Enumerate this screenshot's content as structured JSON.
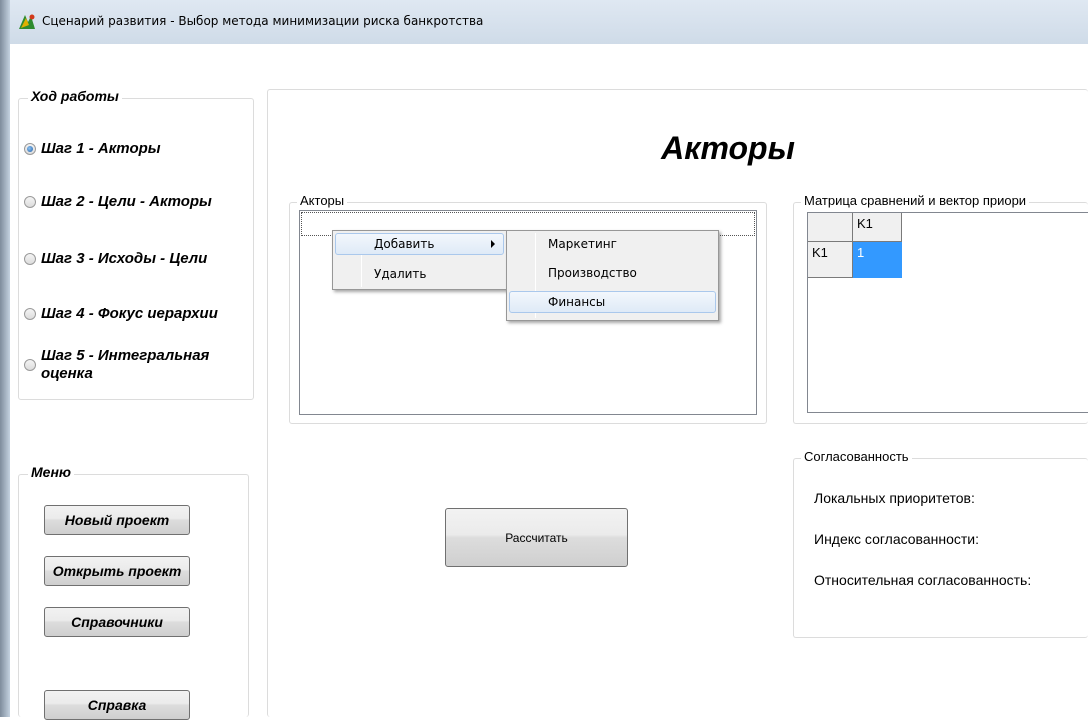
{
  "window": {
    "title": "Сценарий развития - Выбор метода минимизации риска банкротства",
    "icon": "app-logo-icon"
  },
  "progress": {
    "legend": "Ход работы",
    "selected_index": 0,
    "steps": [
      {
        "label": "Шаг 1 - Акторы"
      },
      {
        "label": "Шаг 2 - Цели - Акторы"
      },
      {
        "label": "Шаг 3 - Исходы - Цели"
      },
      {
        "label": "Шаг 4 - Фокус иерархии"
      },
      {
        "label": "Шаг 5 - Интегральная оценка"
      }
    ]
  },
  "menu": {
    "legend": "Меню",
    "new_project": "Новый проект",
    "open_project": "Открыть проект",
    "references": "Справочники",
    "help": "Справка"
  },
  "main": {
    "heading": "Акторы",
    "actors_legend": "Акторы",
    "matrix_legend": "Матрица сравнений  и вектор приори",
    "matrix": {
      "col_headers": [
        "K1"
      ],
      "rows": [
        {
          "header": "K1",
          "values": [
            "1"
          ]
        }
      ]
    },
    "consistency": {
      "legend": "Согласованность",
      "local_priorities": "Локальных приоритетов:",
      "consistency_index": "Индекс согласованности:",
      "relative_consistency": "Относительная согласованность:"
    },
    "calculate_button": "Рассчитать"
  },
  "context_menu": {
    "add": "Добавить",
    "delete": "Удалить",
    "submenu": [
      "Маркетинг",
      "Производство",
      "Финансы"
    ],
    "highlighted_sub": "Финансы"
  },
  "colors": {
    "selected_cell": "#3399ff",
    "menu_highlight": "#dfeaf7",
    "title_bar": "#dfe8f2"
  }
}
